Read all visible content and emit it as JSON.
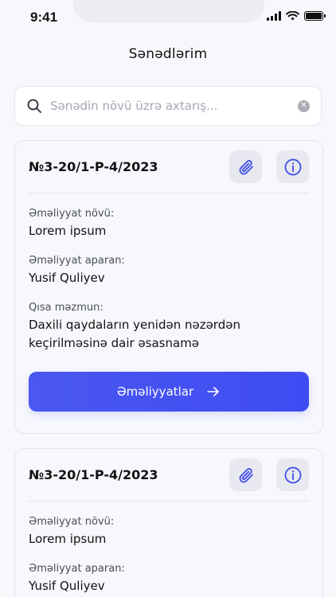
{
  "status_bar": {
    "time": "9:41"
  },
  "header": {
    "title": "Sənədlərim"
  },
  "search": {
    "placeholder": "Sənədin növü üzrə axtarış...",
    "value": ""
  },
  "cards": [
    {
      "doc_number": "№3-20/1-P-4/2023",
      "operation_type_label": "Əməliyyat növü:",
      "operation_type": "Lorem ipsum",
      "operator_label": "Əməliyyat aparan:",
      "operator": "Yusif Quliyev",
      "summary_label": "Qısa məzmun:",
      "summary": "Daxili qaydaların yenidən nəzərdən keçirilməsinə dair əsasnamə",
      "action_label": "Əməliyyatlar"
    },
    {
      "doc_number": "№3-20/1-P-4/2023",
      "operation_type_label": "Əməliyyat növü:",
      "operation_type": "Lorem ipsum",
      "operator_label": "Əməliyyat aparan:",
      "operator": "Yusif Quliyev"
    }
  ],
  "colors": {
    "accent": "#4650F2",
    "icon_accent": "#4856E8",
    "background": "#F7F8FC"
  },
  "icons": {
    "search": "search-icon",
    "clear": "clear-icon",
    "attach": "paperclip-icon",
    "info": "info-icon",
    "arrow": "arrow-right-icon"
  }
}
